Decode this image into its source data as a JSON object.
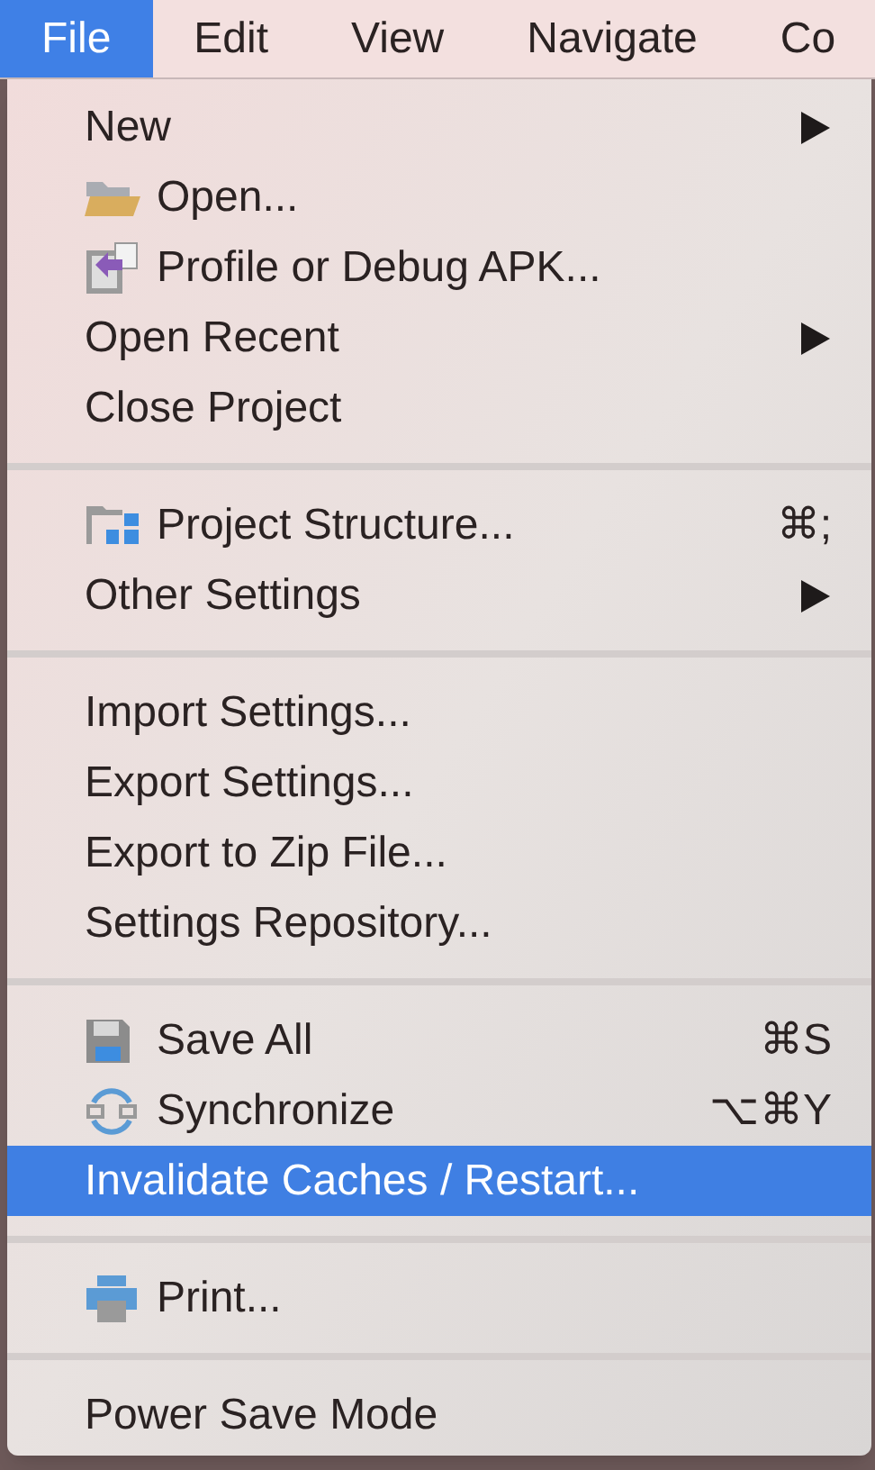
{
  "menu_bar": [
    {
      "label": "File",
      "selected": true
    },
    {
      "label": "Edit",
      "selected": false
    },
    {
      "label": "View",
      "selected": false
    },
    {
      "label": "Navigate",
      "selected": false
    },
    {
      "label": "Co",
      "selected": false
    }
  ],
  "menu": {
    "sections": [
      {
        "items": [
          {
            "label": "New",
            "submenu": true,
            "selected": false
          },
          {
            "label": "Open...",
            "submenu": false,
            "selected": false
          },
          {
            "label": "Profile or Debug APK...",
            "submenu": false,
            "selected": false
          },
          {
            "label": "Open Recent",
            "submenu": true,
            "selected": false
          },
          {
            "label": "Close Project",
            "submenu": false,
            "selected": false
          }
        ]
      },
      {
        "items": [
          {
            "label": "Project Structure...",
            "shortcut": "⌘;",
            "submenu": false,
            "selected": false
          },
          {
            "label": "Other Settings",
            "submenu": true,
            "selected": false
          }
        ]
      },
      {
        "items": [
          {
            "label": "Import Settings...",
            "submenu": false,
            "selected": false
          },
          {
            "label": "Export Settings...",
            "submenu": false,
            "selected": false
          },
          {
            "label": "Export to Zip File...",
            "submenu": false,
            "selected": false
          },
          {
            "label": "Settings Repository...",
            "submenu": false,
            "selected": false
          }
        ]
      },
      {
        "items": [
          {
            "label": "Save All",
            "shortcut": "⌘S",
            "submenu": false,
            "selected": false
          },
          {
            "label": "Synchronize",
            "shortcut": "⌥⌘Y",
            "submenu": false,
            "selected": false
          },
          {
            "label": "Invalidate Caches / Restart...",
            "submenu": false,
            "selected": true
          }
        ]
      },
      {
        "items": [
          {
            "label": "Print...",
            "submenu": false,
            "selected": false
          }
        ]
      },
      {
        "items": [
          {
            "label": "Power Save Mode",
            "submenu": false,
            "selected": false
          }
        ]
      }
    ]
  }
}
